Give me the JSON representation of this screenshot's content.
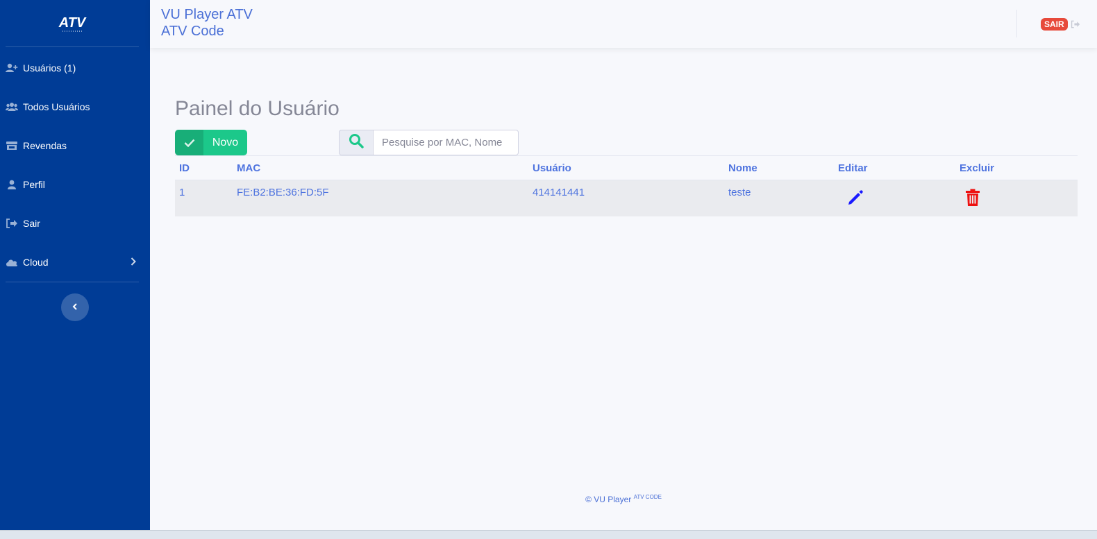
{
  "brand": {
    "logo_text": "ATV"
  },
  "sidebar": {
    "items": [
      {
        "label": "Usuários (1)",
        "icon": "user-plus-icon"
      },
      {
        "label": "Todos Usuários",
        "icon": "users-icon"
      },
      {
        "label": "Revendas",
        "icon": "store-icon"
      },
      {
        "label": "Perfil",
        "icon": "user-icon"
      },
      {
        "label": "Sair",
        "icon": "sign-out-icon"
      },
      {
        "label": "Cloud",
        "icon": "cloud-icon"
      }
    ]
  },
  "header": {
    "title_line1": "VU Player ATV",
    "title_line2": "ATV Code",
    "logout_badge": "SAIR"
  },
  "main": {
    "page_title": "Painel do Usuário",
    "new_button": "Novo",
    "search": {
      "placeholder": "Pesquise por MAC, Nome"
    },
    "table": {
      "headers": {
        "id": "ID",
        "mac": "MAC",
        "user": "Usuário",
        "name": "Nome",
        "edit": "Editar",
        "delete": "Excluir"
      },
      "rows": [
        {
          "id": "1",
          "mac": "FE:B2:BE:36:FD:5F",
          "user": "414141441",
          "name": "teste"
        }
      ]
    }
  },
  "footer": {
    "text": "© VU Player",
    "sup": "ATV CODE"
  },
  "colors": {
    "sidebar": "#003c96",
    "accent": "#4e73df",
    "success": "#1cc88a",
    "danger": "#e74a3b",
    "edit_icon": "#1a1aff",
    "delete_icon": "#ee1111"
  }
}
